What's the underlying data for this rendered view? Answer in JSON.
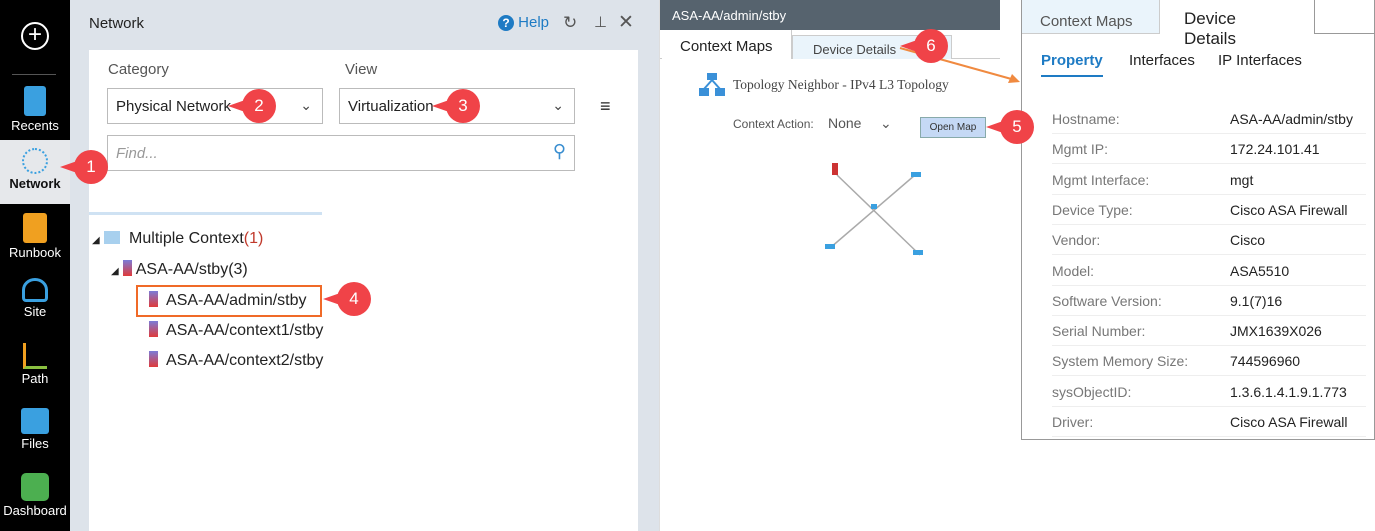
{
  "sidebar": {
    "items": [
      {
        "label": "Recents",
        "icon": "recents-icon"
      },
      {
        "label": "Network",
        "icon": "network-icon"
      },
      {
        "label": "Runbook",
        "icon": "runbook-icon"
      },
      {
        "label": "Site",
        "icon": "site-icon"
      },
      {
        "label": "Path",
        "icon": "path-icon"
      },
      {
        "label": "Files",
        "icon": "files-icon"
      },
      {
        "label": "Dashboard",
        "icon": "dashboard-icon"
      }
    ]
  },
  "network_panel": {
    "title": "Network",
    "help": "Help",
    "category_label": "Category",
    "category_value": "Physical Network",
    "view_label": "View",
    "view_value": "Virtualization",
    "find_placeholder": "Find...",
    "tree": {
      "root": "Multiple Context",
      "root_count": "(1)",
      "device": "ASA-AA/stby(3)",
      "children": [
        "ASA-AA/admin/stby",
        "ASA-AA/context1/stby",
        "ASA-AA/context2/stby"
      ]
    }
  },
  "context_panel": {
    "title": "ASA-AA/admin/stby",
    "tabs": [
      "Context Maps",
      "Device Details"
    ],
    "map_title": "Topology Neighbor - IPv4 L3 Topology",
    "context_action_label": "Context Action:",
    "context_action_value": "None",
    "open_map": "Open Map"
  },
  "device_details": {
    "tabs": [
      "Context Maps",
      "Device Details"
    ],
    "subtabs": [
      "Property",
      "Interfaces",
      "IP Interfaces"
    ],
    "properties": [
      {
        "k": "Hostname:",
        "v": "ASA-AA/admin/stby"
      },
      {
        "k": "Mgmt IP:",
        "v": "172.24.101.41"
      },
      {
        "k": "Mgmt Interface:",
        "v": "mgt"
      },
      {
        "k": "Device Type:",
        "v": "Cisco ASA Firewall"
      },
      {
        "k": "Vendor:",
        "v": "Cisco"
      },
      {
        "k": "Model:",
        "v": "ASA5510"
      },
      {
        "k": "Software Version:",
        "v": "9.1(7)16"
      },
      {
        "k": "Serial Number:",
        "v": "JMX1639X026"
      },
      {
        "k": "System Memory Size:",
        "v": "744596960"
      },
      {
        "k": "sysObjectID:",
        "v": "1.3.6.1.4.1.9.1.773"
      },
      {
        "k": "Driver:",
        "v": "Cisco ASA Firewall"
      }
    ]
  },
  "callouts": [
    "1",
    "2",
    "3",
    "4",
    "5",
    "6"
  ],
  "colors": {
    "accent": "#1e7bc4",
    "callout": "#f04348",
    "highlight": "#f06a28"
  }
}
